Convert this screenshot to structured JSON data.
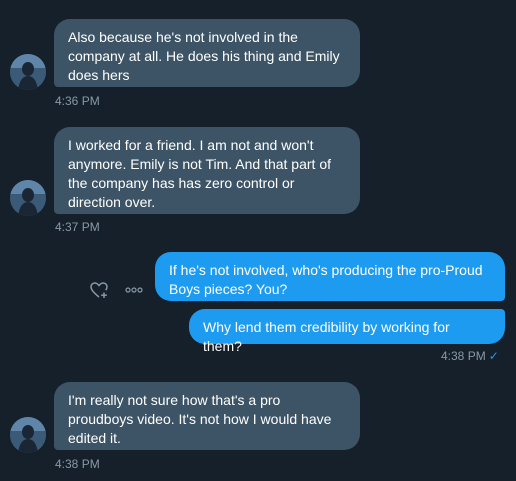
{
  "messages": [
    {
      "direction": "in",
      "text": "Also because he's not involved in the\ncompany at all. He does his thing and Emily\ndoes hers",
      "time": "4:36 PM"
    },
    {
      "direction": "in",
      "text": "I worked for a friend. I am not and won't\nanymore. Emily is not Tim. And that part of\nthe company has has zero control or\ndirection over.",
      "time": "4:37 PM"
    },
    {
      "direction": "out",
      "text": "If he's not involved, who's producing the pro-Proud\nBoys pieces? You?"
    },
    {
      "direction": "out",
      "text": "Why lend them credibility by working for them?",
      "time": "4:38 PM",
      "read_receipt": "✓"
    },
    {
      "direction": "in",
      "text": "I'm really not sure how that's a pro\nproudboys video. It's not how I would have\nedited it.",
      "time": "4:38 PM"
    }
  ],
  "actions": {
    "like_icon": "heart-plus-icon",
    "more_icon": "more-horizontal-icon"
  },
  "colors": {
    "background": "#15202b",
    "incoming_bubble": "#3d5466",
    "outgoing_bubble": "#1d9bf0",
    "timestamp": "#8899a6"
  }
}
